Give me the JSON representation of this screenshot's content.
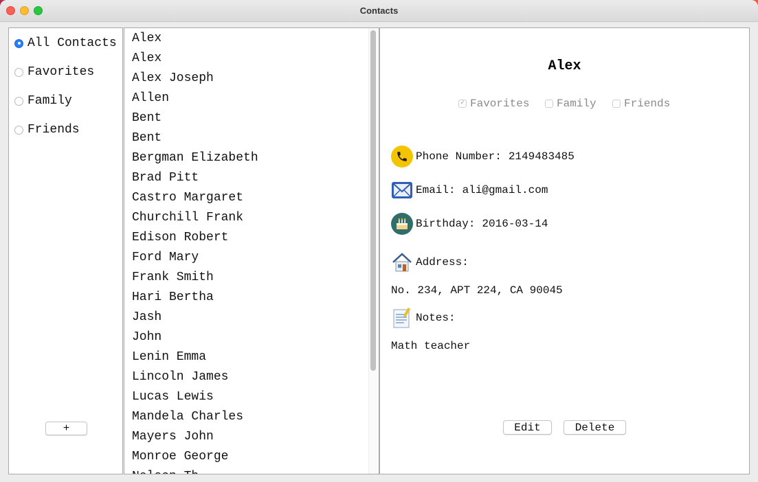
{
  "window": {
    "title": "Contacts"
  },
  "groups": [
    {
      "label": "All Contacts",
      "selected": true
    },
    {
      "label": "Favorites",
      "selected": false
    },
    {
      "label": "Family",
      "selected": false
    },
    {
      "label": "Friends",
      "selected": false
    }
  ],
  "add_button": "+",
  "contacts": [
    "Alex",
    "Alex",
    "Alex Joseph",
    "Allen",
    "Bent",
    "Bent",
    "Bergman Elizabeth",
    "Brad Pitt",
    "Castro Margaret",
    "Churchill Frank",
    "Edison Robert",
    "Ford Mary",
    "Frank Smith",
    "Hari Bertha",
    "Jash",
    "John",
    "Lenin Emma",
    "Lincoln James",
    "Lucas Lewis",
    "Mandela Charles",
    "Mayers John",
    "Monroe George",
    "Nelson Th"
  ],
  "detail": {
    "name": "Alex",
    "tags": [
      {
        "label": "Favorites",
        "checked": true
      },
      {
        "label": "Family",
        "checked": false
      },
      {
        "label": "Friends",
        "checked": false
      }
    ],
    "phone": {
      "label": "Phone Number:",
      "value": "2149483485"
    },
    "email": {
      "label": "Email:",
      "value": "ali@gmail.com"
    },
    "birthday": {
      "label": "Birthday:",
      "value": "2016-03-14"
    },
    "address": {
      "label": "Address:",
      "value": "No. 234, APT 224, CA 90045"
    },
    "notes": {
      "label": "Notes:",
      "value": "Math teacher"
    },
    "edit_button": "Edit",
    "delete_button": "Delete"
  },
  "colors": {
    "accent": "#2a7cf6",
    "phone_icon_bg": "#f5c400",
    "birthday_icon_bg": "#2f6e6a"
  }
}
